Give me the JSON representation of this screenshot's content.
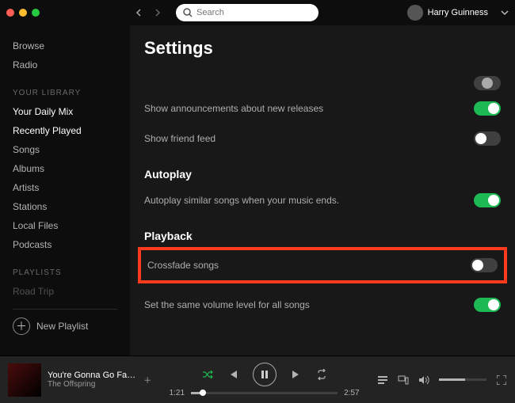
{
  "search": {
    "placeholder": "Search"
  },
  "user": {
    "name": "Harry Guinness"
  },
  "sidebar": {
    "top": [
      "Browse",
      "Radio"
    ],
    "library_header": "YOUR LIBRARY",
    "library": [
      "Your Daily Mix",
      "Recently Played",
      "Songs",
      "Albums",
      "Artists",
      "Stations",
      "Local Files",
      "Podcasts"
    ],
    "playlists_header": "PLAYLISTS",
    "playlists": [
      "Road Trip"
    ],
    "new_playlist": "New Playlist"
  },
  "page": {
    "title": "Settings",
    "rows": {
      "announcements": "Show announcements about new releases",
      "friend_feed": "Show friend feed",
      "autoplay_h": "Autoplay",
      "autoplay_desc": "Autoplay similar songs when your music ends.",
      "playback_h": "Playback",
      "crossfade": "Crossfade songs",
      "normalize": "Set the same volume level for all songs"
    }
  },
  "player": {
    "title": "You're Gonna Go Fa…",
    "artist": "The Offspring",
    "elapsed": "1:21",
    "total": "2:57"
  }
}
